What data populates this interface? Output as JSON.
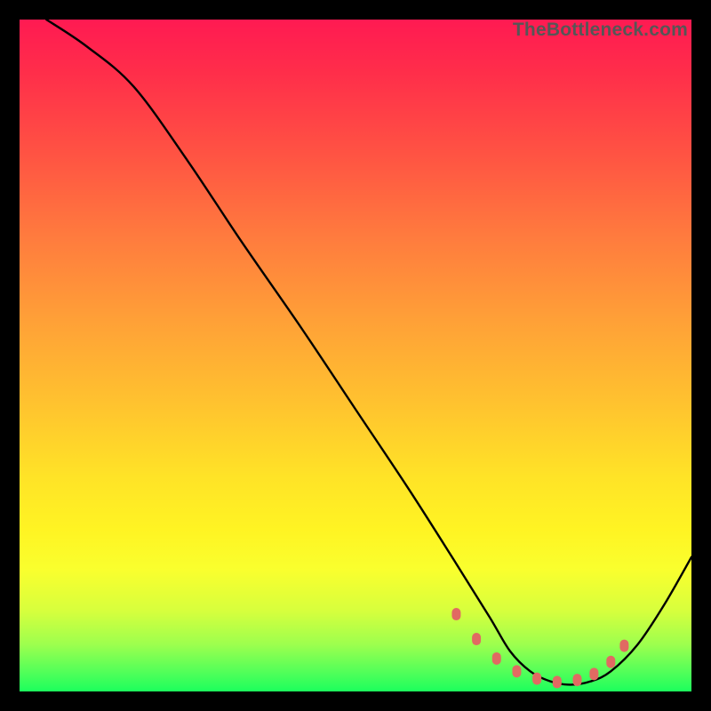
{
  "watermark": "TheBottleneck.com",
  "chart_data": {
    "type": "line",
    "title": "",
    "xlabel": "",
    "ylabel": "",
    "xlim": [
      0,
      100
    ],
    "ylim": [
      0,
      100
    ],
    "series": [
      {
        "name": "bottleneck-curve",
        "x": [
          4,
          10,
          17,
          25,
          33,
          42,
          50,
          58,
          65,
          70,
          73,
          76,
          79,
          82,
          85,
          88,
          92,
          96,
          100
        ],
        "y": [
          100,
          96,
          90,
          79,
          67,
          54,
          42,
          30,
          19,
          11,
          6,
          3,
          1.5,
          1,
          1.5,
          3,
          7,
          13,
          20
        ]
      }
    ],
    "markers": {
      "name": "optimal-range-dots",
      "color": "#e16a62",
      "x": [
        65,
        68,
        71,
        74,
        77,
        80,
        83,
        85.5,
        88,
        90
      ],
      "y": [
        11.5,
        7.8,
        4.9,
        3.0,
        1.9,
        1.4,
        1.7,
        2.6,
        4.4,
        6.8
      ]
    }
  }
}
